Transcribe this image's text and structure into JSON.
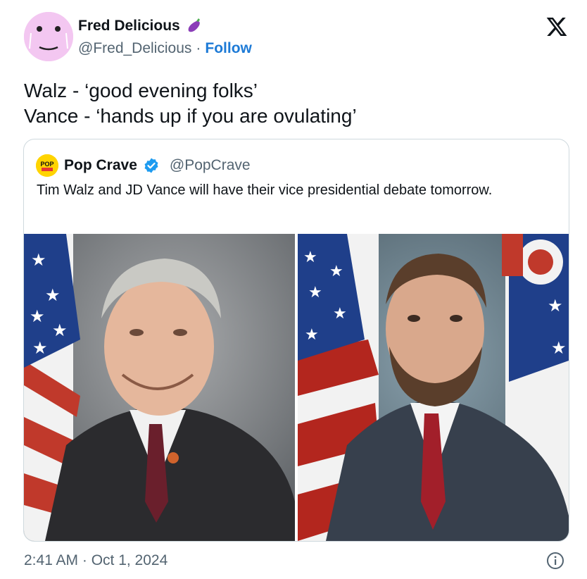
{
  "author": {
    "display_name": "Fred Delicious",
    "emoji": "🍆",
    "handle": "@Fred_Delicious",
    "separator": "·",
    "follow_label": "Follow"
  },
  "tweet": {
    "lines": [
      "Walz - ‘good evening folks’",
      "Vance - ‘hands up if you are ovulating’"
    ]
  },
  "quoted": {
    "name": "Pop Crave",
    "handle": "@PopCrave",
    "verified": true,
    "avatar_text": "POP",
    "text": "Tim Walz and JD Vance will have their vice presidential debate tomorrow.",
    "images": [
      "Tim Walz portrait",
      "JD Vance portrait"
    ]
  },
  "footer": {
    "timestamp": "2:41 AM · Oct 1, 2024"
  },
  "colors": {
    "accent": "#1d7ad6",
    "muted": "#536471",
    "border": "#cfd9de",
    "verified": "#1d9bf0"
  },
  "icons": [
    "x-logo-icon",
    "info-icon",
    "verified-badge-icon",
    "eggplant-icon"
  ]
}
